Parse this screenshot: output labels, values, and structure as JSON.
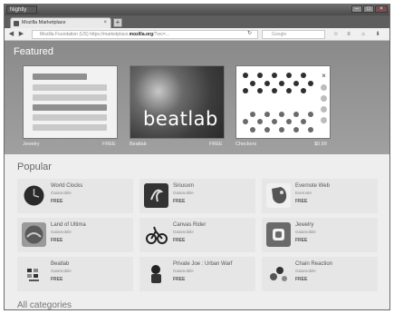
{
  "browser": {
    "app_menu_label": "Nightly",
    "tab_title": "Mozilla Marketplace",
    "url_prefix": "Mozilla Foundation (US)  https://marketplace.",
    "url_domain": "mozilla.org",
    "url_suffix": "/?src=...",
    "search_placeholder": "Google"
  },
  "featured": {
    "title": "Featured",
    "cards": [
      {
        "name": "Jewelry",
        "price": "FREE"
      },
      {
        "name": "Beatlab",
        "price": "FREE"
      },
      {
        "name": "Checkers",
        "price": "$0.99"
      }
    ],
    "beatlab_logo_text": "beatlab"
  },
  "popular": {
    "title": "Popular",
    "apps": [
      {
        "name": "World Clocks",
        "developer": "Gaiamobile",
        "price": "FREE"
      },
      {
        "name": "Siriusxm",
        "developer": "Gaiamobile",
        "price": "FREE"
      },
      {
        "name": "Evernote Web",
        "developer": "Evernote",
        "price": "FREE"
      },
      {
        "name": "Land of Ultima",
        "developer": "Gaiamobile",
        "price": "FREE"
      },
      {
        "name": "Canvas Rider",
        "developer": "Gaiamobile",
        "price": "FREE"
      },
      {
        "name": "Jewelry",
        "developer": "Gaiamobile",
        "price": "FREE"
      },
      {
        "name": "Beatlab",
        "developer": "Gaiamobile",
        "price": "FREE"
      },
      {
        "name": "Private Joe : Urban Warf",
        "developer": "Gaiamobile",
        "price": "FREE"
      },
      {
        "name": "Chain Reaction",
        "developer": "Gaiamobile",
        "price": "FREE"
      }
    ]
  },
  "all_categories_label": "All categories"
}
